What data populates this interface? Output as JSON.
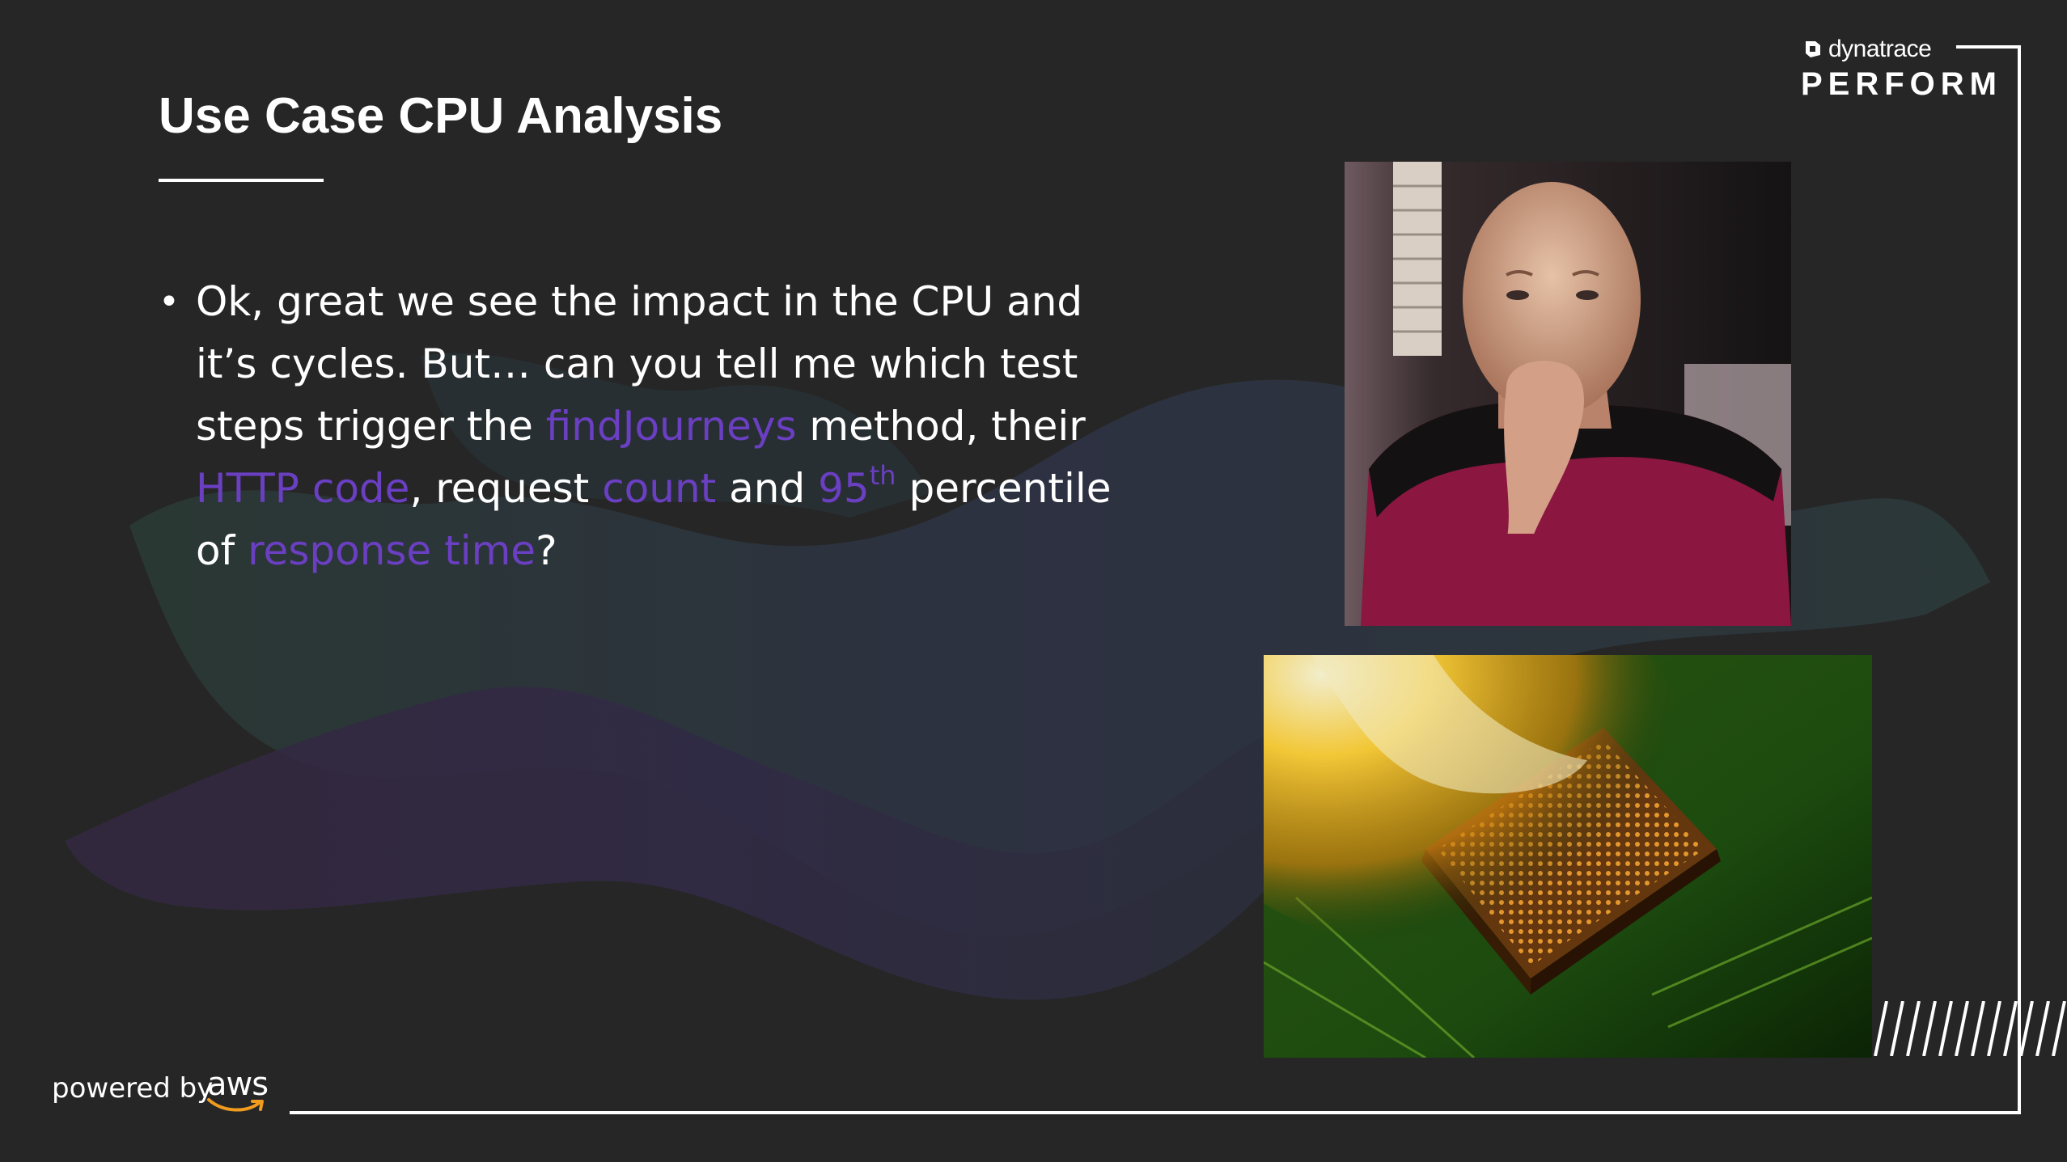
{
  "slide": {
    "title": "Use Case CPU Analysis",
    "bullet": {
      "marker": "•",
      "t1": "Ok, great we see the impact in the CPU and it’s cycles. But… can you tell me which test steps trigger the ",
      "h1": "findJourneys",
      "t2": " method, their ",
      "h2": "HTTP code",
      "t3": ", request ",
      "h3": "count",
      "t4": " and ",
      "h4": "95",
      "h4_sup": "th",
      "t5": " percentile of ",
      "h5": "response time",
      "t6": "?"
    }
  },
  "branding": {
    "brand_name": "dynatrace",
    "event_name": "PERFORM",
    "powered_by": "powered by",
    "sponsor": "aws"
  },
  "images": {
    "photo_1": "thinking-man-icon",
    "photo_2": "burning-cpu-chip-icon"
  },
  "colors": {
    "background": "#262626",
    "highlight": "#6a3fc2",
    "text": "#ffffff",
    "aws_smile": "#f29c1f"
  }
}
